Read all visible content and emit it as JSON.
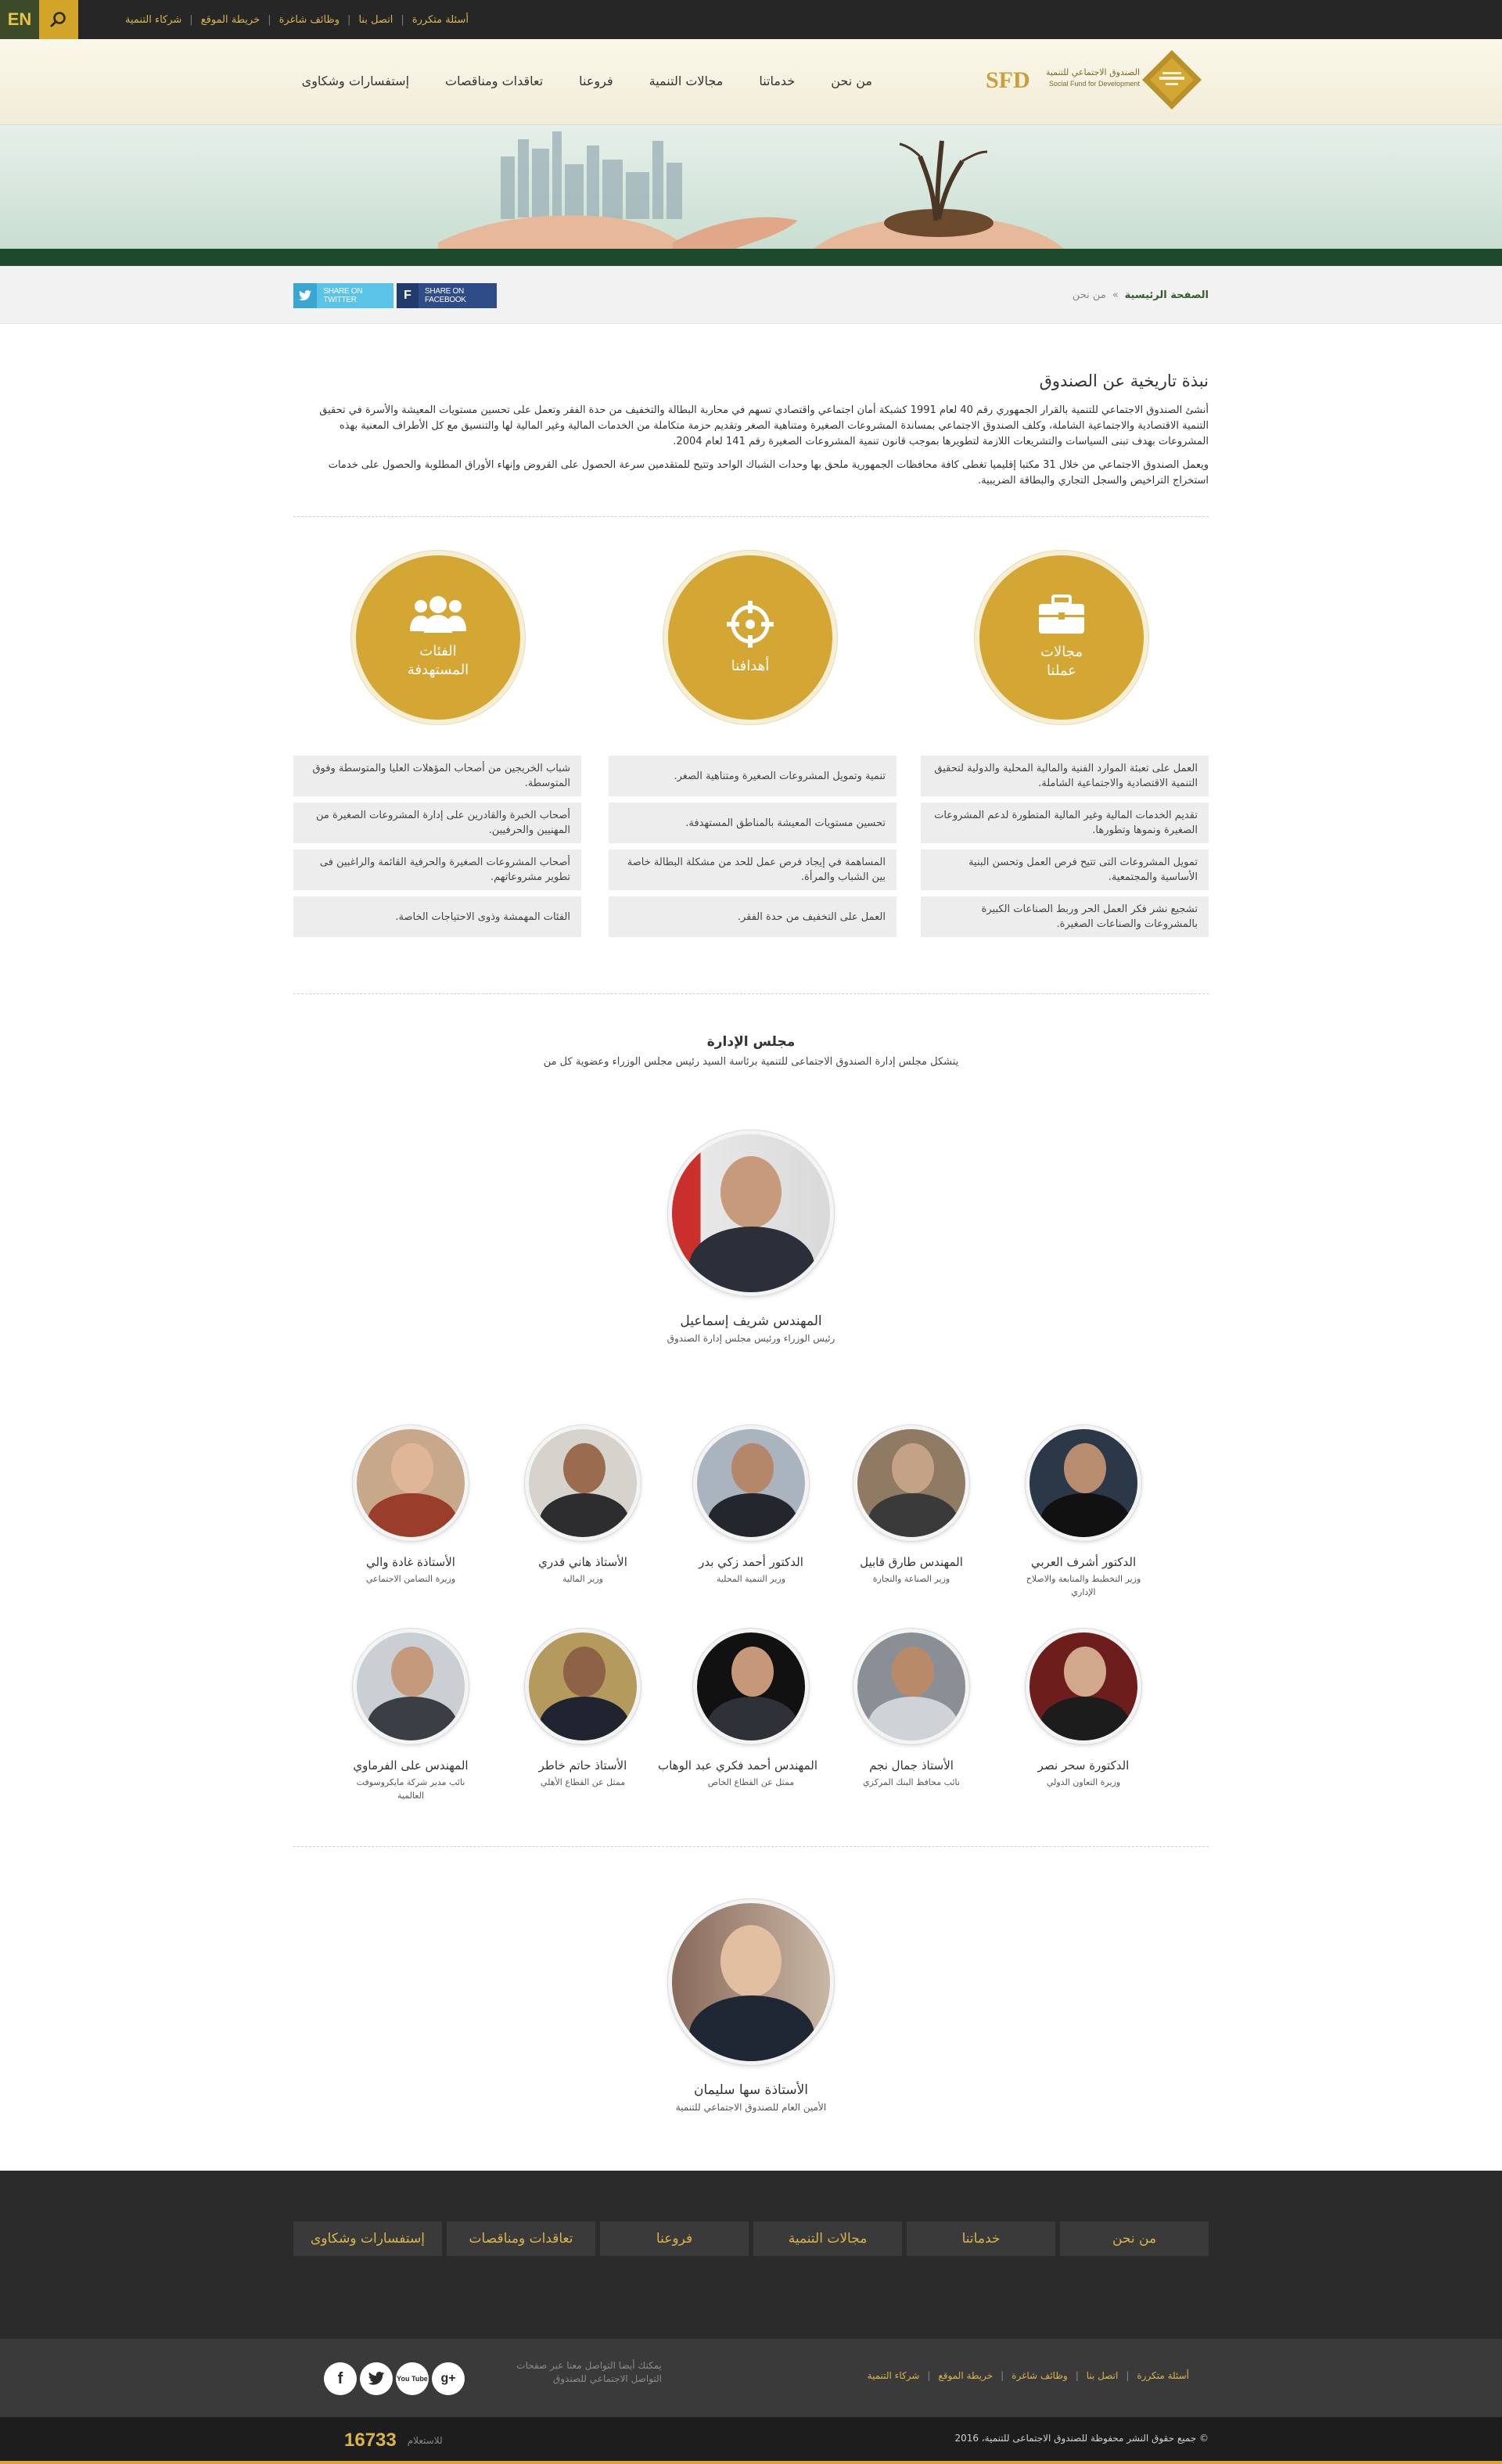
{
  "topbar": {
    "lang": "EN",
    "links": [
      "أسئلة متكررة",
      "اتصل بنا",
      "وظائف شاغرة",
      "خريطة الموقع",
      "شركاء التنمية"
    ]
  },
  "logo": {
    "arabic": "الصندوق الاجتماعي للتنمية",
    "abbr": "SFD",
    "english": "Social Fund for Development"
  },
  "nav": [
    "من نحن",
    "خدماتنا",
    "مجالات التنمية",
    "فروعنا",
    "تعاقدات ومناقصات",
    "إستفسارات وشكاوى"
  ],
  "breadcrumb": {
    "home": "الصفحة الرئيسية",
    "separator": "»",
    "current": "من نحن"
  },
  "share": {
    "twitter": "SHARE ON TWITTER",
    "facebook": "SHARE ON FACEBOOK"
  },
  "about": {
    "title": "نبذة تاريخية عن الصندوق",
    "p1": "أنشئ الصندوق الاجتماعي للتنمية بالقرار الجمهوري رقم 40 لعام 1991 كشبكة أمان اجتماعي واقتصادي تسهم في محاربة البطالة والتخفيف من حدة الفقر وتعمل على تحسين مستويات المعيشة والأسرة في تحقيق التنمية الاقتصادية والاجتماعية الشاملة، وكلف الصندوق الاجتماعي بمساندة المشروعات الصغيرة ومتناهية الصغر وتقديم حزمة متكاملة من الخدمات المالية وغير المالية لها والتنسيق مع كل الأطراف المعنية بهذه المشروعات بهدف تبنى السياسات والتشريعات اللازمة لتطويرها بموجب قانون تنمية المشروعات الصغيرة رقم 141 لعام 2004.",
    "p2": "ويعمل الصندوق الاجتماعي من خلال 31 مكتبا إقليميا تغطى كافة محافظات الجمهورية ملحق بها وحدات الشباك الواحد وتتيح للمتقدمين سرعة الحصول على القروض وإنهاء الأوراق المطلوبة والحصول على خدمات استخراج التراخيص والسجل التجاري والبطاقة الضريبية."
  },
  "pillars": [
    {
      "title": "مجالات عملنا",
      "icon": "briefcase-icon",
      "items": [
        "العمل على تعبئة الموارد الفنية والمالية المحلية والدولية لتحقيق التنمية الاقتصادية والاجتماعية الشاملة.",
        "تقديم الخدمات المالية وغير المالية المتطورة لدعم المشروعات الصغيرة ونموها وتطورها.",
        "تمويل المشروعات التى تتيح فرص العمل وتحسن البنية الأساسية والمجتمعية.",
        "تشجيع نشر فكر العمل الحر وربط الصناعات الكبيرة بالمشروعات والصناعات الصغيرة."
      ]
    },
    {
      "title": "أهدافنا",
      "icon": "target-icon",
      "items": [
        "تنمية وتمويل المشروعات الصغيرة ومتناهية الصغر.",
        "تحسين مستويات المعيشة بالمناطق المستهدفة.",
        "المساهمة في إيجاد فرص عمل للحد من مشكلة البطالة خاصة بين الشباب والمرأة.",
        "العمل على التخفيف من حدة الفقر."
      ]
    },
    {
      "title": "الفئات المستهدفة",
      "icon": "group-icon",
      "items": [
        "شباب الخريجين من أصحاب المؤهلات العليا والمتوسطة وفوق المتوسطة.",
        "أصحاب الخبرة والقادرين على إدارة المشروعات الصغيرة من المهنيين والحرفيين.",
        "أصحاب المشروعات الصغيرة والحرفية القائمة والراغبين فى تطوير مشروعاتهم.",
        "الفئات المهمشة وذوى الاحتياجات الخاصة."
      ]
    }
  ],
  "board": {
    "title": "مجلس الإدارة",
    "subtitle": "يتشكل مجلس إدارة الصندوق الاجتماعى للتنمية برئاسة السيد رئيس مجلس الوزراء وعضوية كل من",
    "chair": {
      "name": "المهندس شريف إسماعيل",
      "role": "رئيس الوزراء ورئيس مجلس إدارة الصندوق"
    },
    "row1": [
      {
        "name": "الدكتور أشرف العربي",
        "role": "وزير التخطيط والمتابعة والاصلاح الإداري"
      },
      {
        "name": "المهندس طارق قابيل",
        "role": "وزير الصناعة والتجارة"
      },
      {
        "name": "الدكتور أحمد زكي بدر",
        "role": "وزير التنمية المحلية"
      },
      {
        "name": "الأستاذ هاني قدري",
        "role": "وزير المالية"
      },
      {
        "name": "الأستاذة غادة والي",
        "role": "وزيرة التضامن الاجتماعي"
      }
    ],
    "row2": [
      {
        "name": "الدكتورة سحر نصر",
        "role": "وزيرة التعاون الدولي"
      },
      {
        "name": "الأستاذ جمال نجم",
        "role": "نائب محافظ البنك المركزي"
      },
      {
        "name": "المهندس أحمد فكري عبد الوهاب",
        "role": "ممثل عن القطاع الخاص"
      },
      {
        "name": "الأستاذ حاتم خاطر",
        "role": "ممثل عن القطاع الأهلي"
      },
      {
        "name": "المهندس على الفرماوي",
        "role": "نائب مدير شركة مايكروسوفت العالمية"
      }
    ],
    "secretary": {
      "name": "الأستاذة سها سليمان",
      "role": "الأمين العام للصندوق الاجتماعي للتنمية"
    }
  },
  "footer": {
    "nav": [
      "من نحن",
      "خدماتنا",
      "مجالات التنمية",
      "فروعنا",
      "تعاقدات ومناقصات",
      "إستفسارات وشكاوى"
    ],
    "links": [
      "أسئلة متكررة",
      "اتصل بنا",
      "وظائف شاغرة",
      "خريطة الموقع",
      "شركاء التنمية"
    ],
    "social_text": "يمكنك أيضا التواصل معنا عبر صفحات التواصل الاجتماعي للصندوق",
    "social": [
      "f",
      "t",
      "You Tube",
      "g+"
    ],
    "copyright": "© جميع حقوق النشر محفوظة للصندوق الاجتماعى للتنمية، 2016",
    "inquiry_label": "للاستعلام",
    "inquiry_number": "16733"
  },
  "colors": {
    "gold": "#d4a634",
    "dark": "#262626",
    "green": "#1d4a2b"
  }
}
